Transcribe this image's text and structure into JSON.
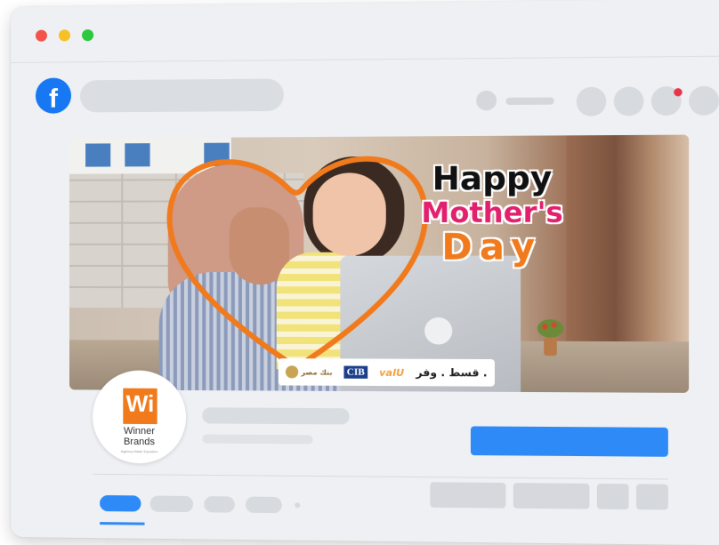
{
  "browser": {
    "controls": [
      "close",
      "minimize",
      "maximize"
    ]
  },
  "header": {
    "logo_letter": "f",
    "notification_color": "#e8334a"
  },
  "cover": {
    "greeting_line1": "Happy",
    "greeting_line2": "Mother's",
    "greeting_line3": "Day",
    "partners": {
      "banque_misr": "بنك مصر",
      "cib": "CIB",
      "valu": "valU",
      "slogan": "قسط . وفر ."
    }
  },
  "profile": {
    "logo_mark": "Wi",
    "name_line1": "Winner",
    "name_line2": "Brands",
    "tagline": "Agency Made Eqvation"
  },
  "colors": {
    "brand_blue": "#1877f2",
    "primary_button": "#2e8af7",
    "accent_orange": "#f07a1c",
    "accent_pink": "#e2206e"
  }
}
